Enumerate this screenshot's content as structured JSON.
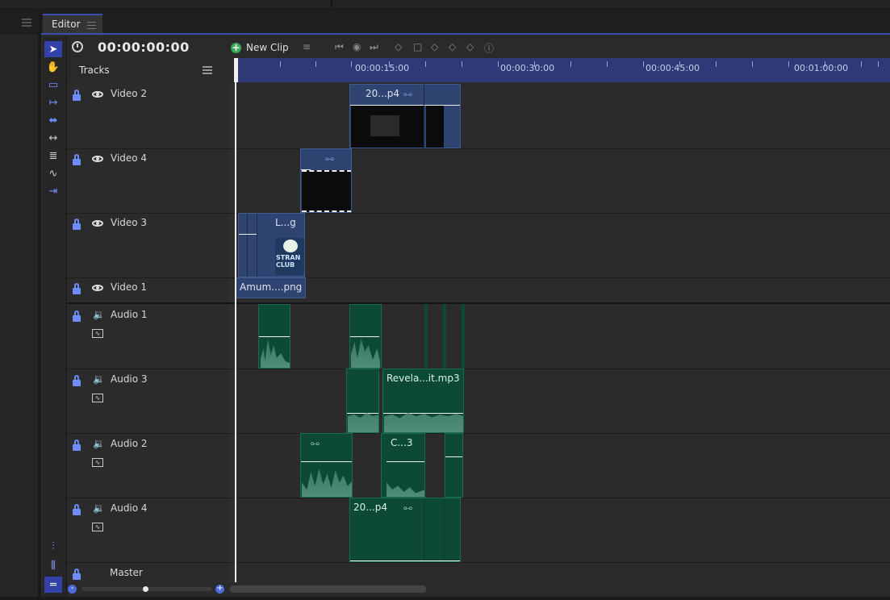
{
  "window": {
    "tab_label": "Editor"
  },
  "header": {
    "timecode": "00:00:00:00",
    "new_clip_label": "New Clip",
    "tracks_label": "Tracks"
  },
  "ruler": {
    "labels": [
      "00:00:15:00",
      "00:00:30:00",
      "00:00:45:00",
      "00:01:00:00"
    ]
  },
  "tracks": [
    {
      "name": "Video 2",
      "kind": "video"
    },
    {
      "name": "Video 4",
      "kind": "video"
    },
    {
      "name": "Video 3",
      "kind": "video"
    },
    {
      "name": "Video 1",
      "kind": "video"
    },
    {
      "name": "Audio 1",
      "kind": "audio"
    },
    {
      "name": "Audio 3",
      "kind": "audio"
    },
    {
      "name": "Audio 2",
      "kind": "audio"
    },
    {
      "name": "Audio 4",
      "kind": "audio"
    },
    {
      "name": "Master",
      "kind": "master"
    }
  ],
  "clips": {
    "video2_clip": "20...p4",
    "video3_clip": "L...g",
    "video1_clip": "Amum....png",
    "audio3_clip": "Revela...it.mp3",
    "audio2_clip": "C...3",
    "audio4_clip": "20...p4",
    "logo_text": "STRAN CLUB"
  },
  "icons": {
    "tools": [
      "pointer-icon",
      "hand-icon",
      "razor-icon",
      "ripple-icon",
      "slip-icon",
      "slide-icon",
      "stretch-icon",
      "curve-icon",
      "insert-icon"
    ],
    "bottom_tools": [
      "mixer-icon",
      "tracks-height-icon",
      "link-icon"
    ]
  },
  "colors": {
    "accent": "#3b4fb0",
    "ruler": "#2e3a78",
    "video_clip": "#2f4470",
    "audio_clip": "#0d4a35",
    "add_button": "#3aaa5a"
  }
}
